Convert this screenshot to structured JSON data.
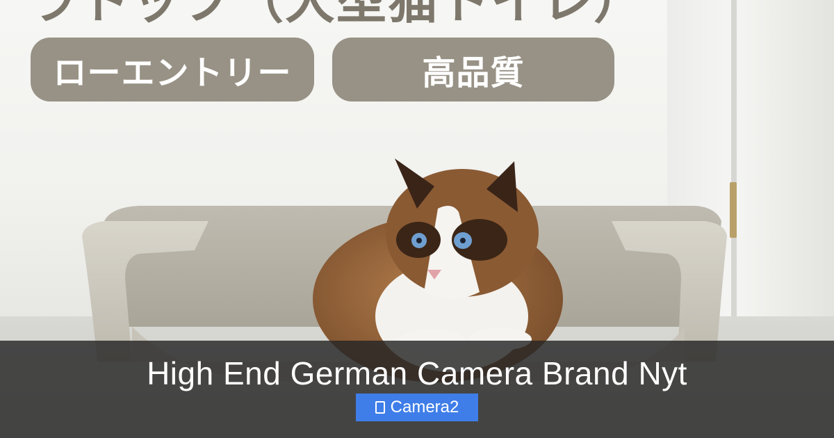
{
  "image": {
    "top_text_fragment": "ラトップ（大型猫トイレ）",
    "badges": [
      "ローエントリー",
      "高品質"
    ]
  },
  "caption": {
    "title": "High End German Camera Brand Nyt",
    "tag_label": "Camera2",
    "tag_icon": "folder-icon",
    "tag_color": "#3f7ee8"
  }
}
